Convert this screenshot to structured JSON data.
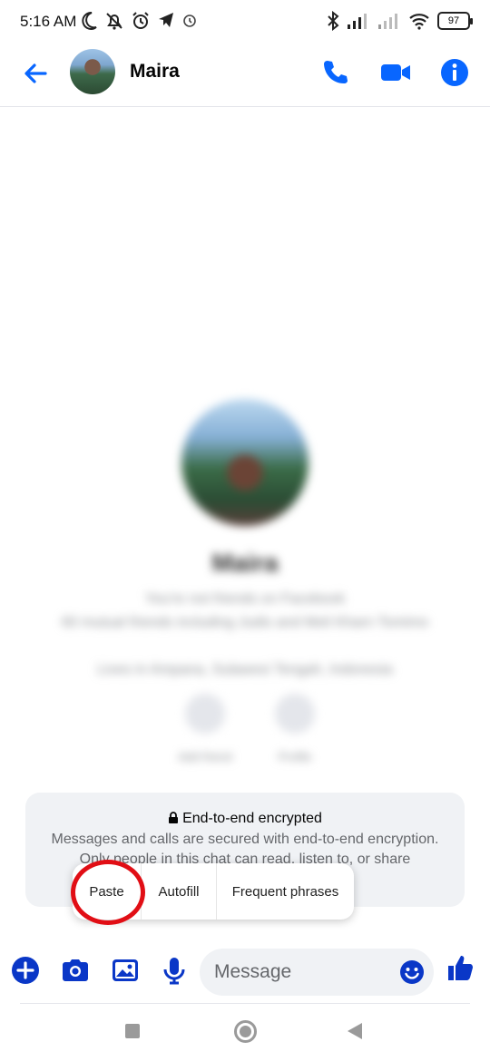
{
  "status_bar": {
    "time": "5:16 AM",
    "battery": "97"
  },
  "header": {
    "contact_name": "Maira"
  },
  "profile": {
    "name": "Maira",
    "line1": "You're not friends on Facebook",
    "line2": "60 mutual friends including Judis and Meli Kharn Tomimo",
    "line3": "Lives in Ampana, Sulawesi Tengah, Indonesia",
    "action1": "Add friend",
    "action2": "Profile"
  },
  "encryption": {
    "title": "End-to-end encrypted",
    "text1": "Messages and calls are secured with end-to-end encryption.",
    "text2": "Only people in this chat can read, listen to, or share"
  },
  "context_menu": {
    "items": [
      "Paste",
      "Autofill",
      "Frequent phrases"
    ]
  },
  "composer": {
    "placeholder": "Message"
  },
  "colors": {
    "messenger_blue": "#0866ff",
    "accent_dark_blue": "#0a37c7",
    "highlight_red": "#e10e15"
  }
}
